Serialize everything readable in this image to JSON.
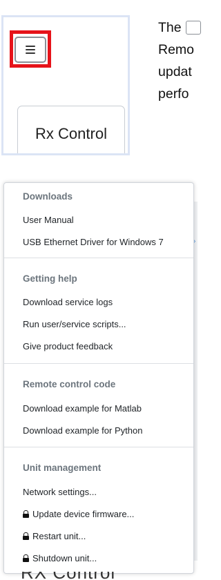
{
  "inset": {
    "tab_label": "Rx Control"
  },
  "body_text": {
    "line1": "The",
    "line2": "Remo",
    "line3": "updat",
    "line4": "perfo"
  },
  "menu": {
    "sections": [
      {
        "header": "Downloads",
        "items": [
          "User Manual",
          "USB Ethernet Driver for Windows 7"
        ]
      },
      {
        "header": "Getting help",
        "items": [
          "Download service logs",
          "Run user/service scripts...",
          "Give product feedback"
        ]
      },
      {
        "header": "Remote control code",
        "items": [
          "Download example for Matlab",
          "Download example for Python"
        ]
      },
      {
        "header": "Unit management",
        "items": [
          "Network settings...",
          "Update device firmware...",
          "Restart unit...",
          "Shutdown unit..."
        ],
        "locked_items": [
          "Update device firmware...",
          "Restart unit...",
          "Shutdown unit..."
        ]
      }
    ]
  },
  "bottom_cut_text": "RX Control",
  "icons": {
    "hamburger": "hamburger-menu-icon",
    "lock": "lock-icon"
  },
  "colors": {
    "highlight": "#e6131a",
    "header_text": "#6c757d",
    "item_text": "#212529"
  }
}
